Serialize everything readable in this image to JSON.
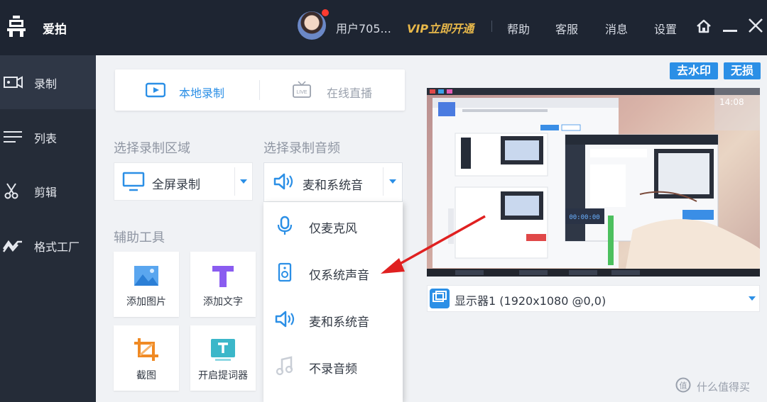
{
  "titlebar": {
    "app_name": "爱拍",
    "username": "用户705...",
    "vip_label": "VIP立即开通",
    "help": "帮助",
    "support": "客服",
    "messages": "消息",
    "settings": "设置"
  },
  "sidebar": {
    "items": [
      {
        "label": "录制",
        "icon": "camera-icon"
      },
      {
        "label": "列表",
        "icon": "list-icon"
      },
      {
        "label": "剪辑",
        "icon": "scissors-icon"
      },
      {
        "label": "格式工厂",
        "icon": "convert-icon"
      }
    ]
  },
  "record_tabs": {
    "local": "本地录制",
    "live": "在线直播",
    "live_icon_text": "LIVE"
  },
  "region": {
    "label": "选择录制区域",
    "value": "全屏录制"
  },
  "audio": {
    "label": "选择录制音频",
    "value": "麦和系统音",
    "options": [
      "仅麦克风",
      "仅系统声音",
      "麦和系统音",
      "不录音频"
    ]
  },
  "tools": {
    "label": "辅助工具",
    "items": [
      "添加图片",
      "添加文字",
      "截图",
      "开启提词器"
    ]
  },
  "badges": {
    "remove_watermark": "去水印",
    "lossless": "无损"
  },
  "monitor": {
    "value": "显示器1 (1920x1080 @0,0)"
  },
  "preview": {
    "clock": "14:08",
    "timer": "00:00:00"
  },
  "watermark": {
    "text": "什么值得买"
  },
  "colors": {
    "accent": "#2b8fe6",
    "titlebar": "#1e2532",
    "sidebar": "#252c38",
    "vip": "#e8b84a",
    "arrow": "#e02020"
  }
}
